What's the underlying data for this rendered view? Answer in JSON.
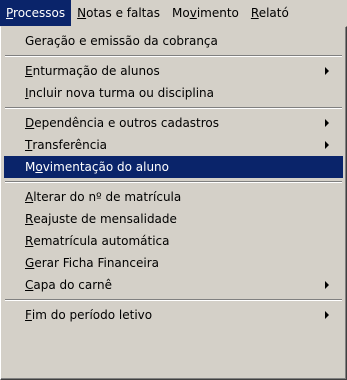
{
  "menubar": {
    "items": [
      {
        "label": "Processos",
        "accel": "P",
        "rest": "rocessos"
      },
      {
        "label": "Notas e faltas",
        "accel": "N",
        "rest": "otas e faltas"
      },
      {
        "label": "Movimento",
        "pre": "Mo",
        "accel": "v",
        "rest": "imento"
      },
      {
        "label": "Relatórios",
        "accel": "R",
        "rest": "elató"
      }
    ]
  },
  "menu": {
    "items": [
      {
        "pre": "",
        "accel": "",
        "rest": "Geração e emissão da cobrança"
      },
      {
        "pre": "",
        "accel": "E",
        "rest": "nturmação de alunos"
      },
      {
        "pre": "",
        "accel": "I",
        "rest": "ncluir nova turma ou disciplina"
      },
      {
        "pre": "",
        "accel": "D",
        "rest": "ependência e outros cadastros"
      },
      {
        "pre": "",
        "accel": "T",
        "rest": "ransferência"
      },
      {
        "pre": "M",
        "accel": "o",
        "rest": "vimentação do aluno"
      },
      {
        "pre": "",
        "accel": "A",
        "rest": "lterar do nº de matrícula"
      },
      {
        "pre": "",
        "accel": "R",
        "rest": "eajuste de mensalidade"
      },
      {
        "pre": "",
        "accel": "R",
        "rest": "ematrícula automática"
      },
      {
        "pre": "",
        "accel": "G",
        "rest": "erar Ficha Financeira"
      },
      {
        "pre": "",
        "accel": "C",
        "rest": "apa do carnê"
      },
      {
        "pre": "",
        "accel": "F",
        "rest": "im do período letivo"
      }
    ]
  },
  "colors": {
    "highlight": "#0a246a",
    "menu_bg": "#d4d0c8"
  },
  "icons": {
    "submenu_arrow": "submenu-arrow-icon"
  }
}
